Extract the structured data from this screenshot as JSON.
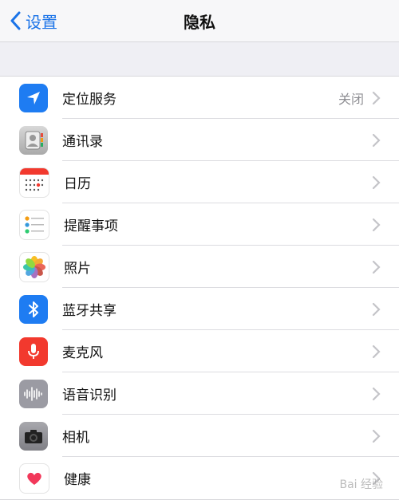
{
  "nav": {
    "back_label": "设置",
    "title": "隐私"
  },
  "rows": [
    {
      "label": "定位服务",
      "value": "关闭",
      "icon": "location-arrow-icon",
      "color": "#1e7cf2"
    },
    {
      "label": "通讯录",
      "value": "",
      "icon": "contacts-icon",
      "color": "#9a9a9a"
    },
    {
      "label": "日历",
      "value": "",
      "icon": "calendar-icon",
      "color": "#ffffff"
    },
    {
      "label": "提醒事项",
      "value": "",
      "icon": "reminders-icon",
      "color": "#ffffff"
    },
    {
      "label": "照片",
      "value": "",
      "icon": "photos-icon",
      "color": "#ffffff"
    },
    {
      "label": "蓝牙共享",
      "value": "",
      "icon": "bluetooth-icon",
      "color": "#1e7cf2"
    },
    {
      "label": "麦克风",
      "value": "",
      "icon": "microphone-icon",
      "color": "#f2392e"
    },
    {
      "label": "语音识别",
      "value": "",
      "icon": "speech-recognition-icon",
      "color": "#9b9ba3"
    },
    {
      "label": "相机",
      "value": "",
      "icon": "camera-icon",
      "color": "#8e8e93"
    },
    {
      "label": "健康",
      "value": "",
      "icon": "health-heart-icon",
      "color": "#ffffff"
    }
  ],
  "watermark": "Bai 经验"
}
